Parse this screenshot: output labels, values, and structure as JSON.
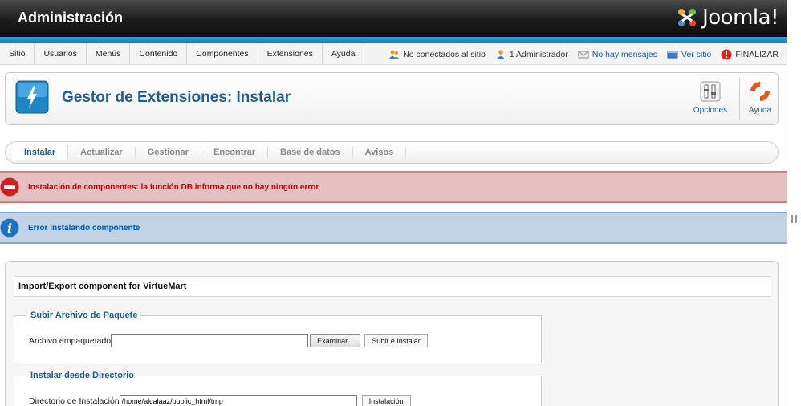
{
  "header": {
    "title": "Administración",
    "brand": "Joomla!"
  },
  "menu": {
    "items": [
      "Sitio",
      "Usuarios",
      "Menús",
      "Contenido",
      "Componentes",
      "Extensiones",
      "Ayuda"
    ]
  },
  "status": {
    "offline": "No conectados al sitio",
    "admins": "1 Administrador",
    "messages": "No hay mensajes",
    "view_site": "Ver sitio",
    "logout": "FINALIZAR"
  },
  "toolbar": {
    "heading": "Gestor de Extensiones: Instalar",
    "options_label": "Opciones",
    "help_label": "Ayuda"
  },
  "tabs": [
    {
      "label": "Instalar",
      "active": true
    },
    {
      "label": "Actualizar",
      "active": false
    },
    {
      "label": "Gestionar",
      "active": false
    },
    {
      "label": "Encontrar",
      "active": false
    },
    {
      "label": "Base de datos",
      "active": false
    },
    {
      "label": "Avisos",
      "active": false
    }
  ],
  "messages": {
    "error": "Instalación de componentes: la función DB informa que no hay ningún error",
    "info": "Error instalando componente"
  },
  "content": {
    "component_title": "Import/Export component for VirtueMart",
    "upload": {
      "legend": "Subir Archivo de Paquete",
      "label": "Archivo empaquetado",
      "file_value": "",
      "browse_button": "Examinar...",
      "submit_button": "Subir e Instalar"
    },
    "directory": {
      "legend": "Instalar desde Directorio",
      "label": "Directorio de Instalación",
      "path_value": "/home/alcalaaz/public_html/tmp",
      "submit_button": "Instalación"
    }
  },
  "colors": {
    "header_bg": "#1c1c1c",
    "accent_blue": "#1d75b6",
    "heading_blue": "#1d5e8f",
    "error_bg": "#e6c0c0",
    "error_text": "#cc0000",
    "info_bg": "#c3d2e5",
    "info_text": "#0055bb"
  }
}
